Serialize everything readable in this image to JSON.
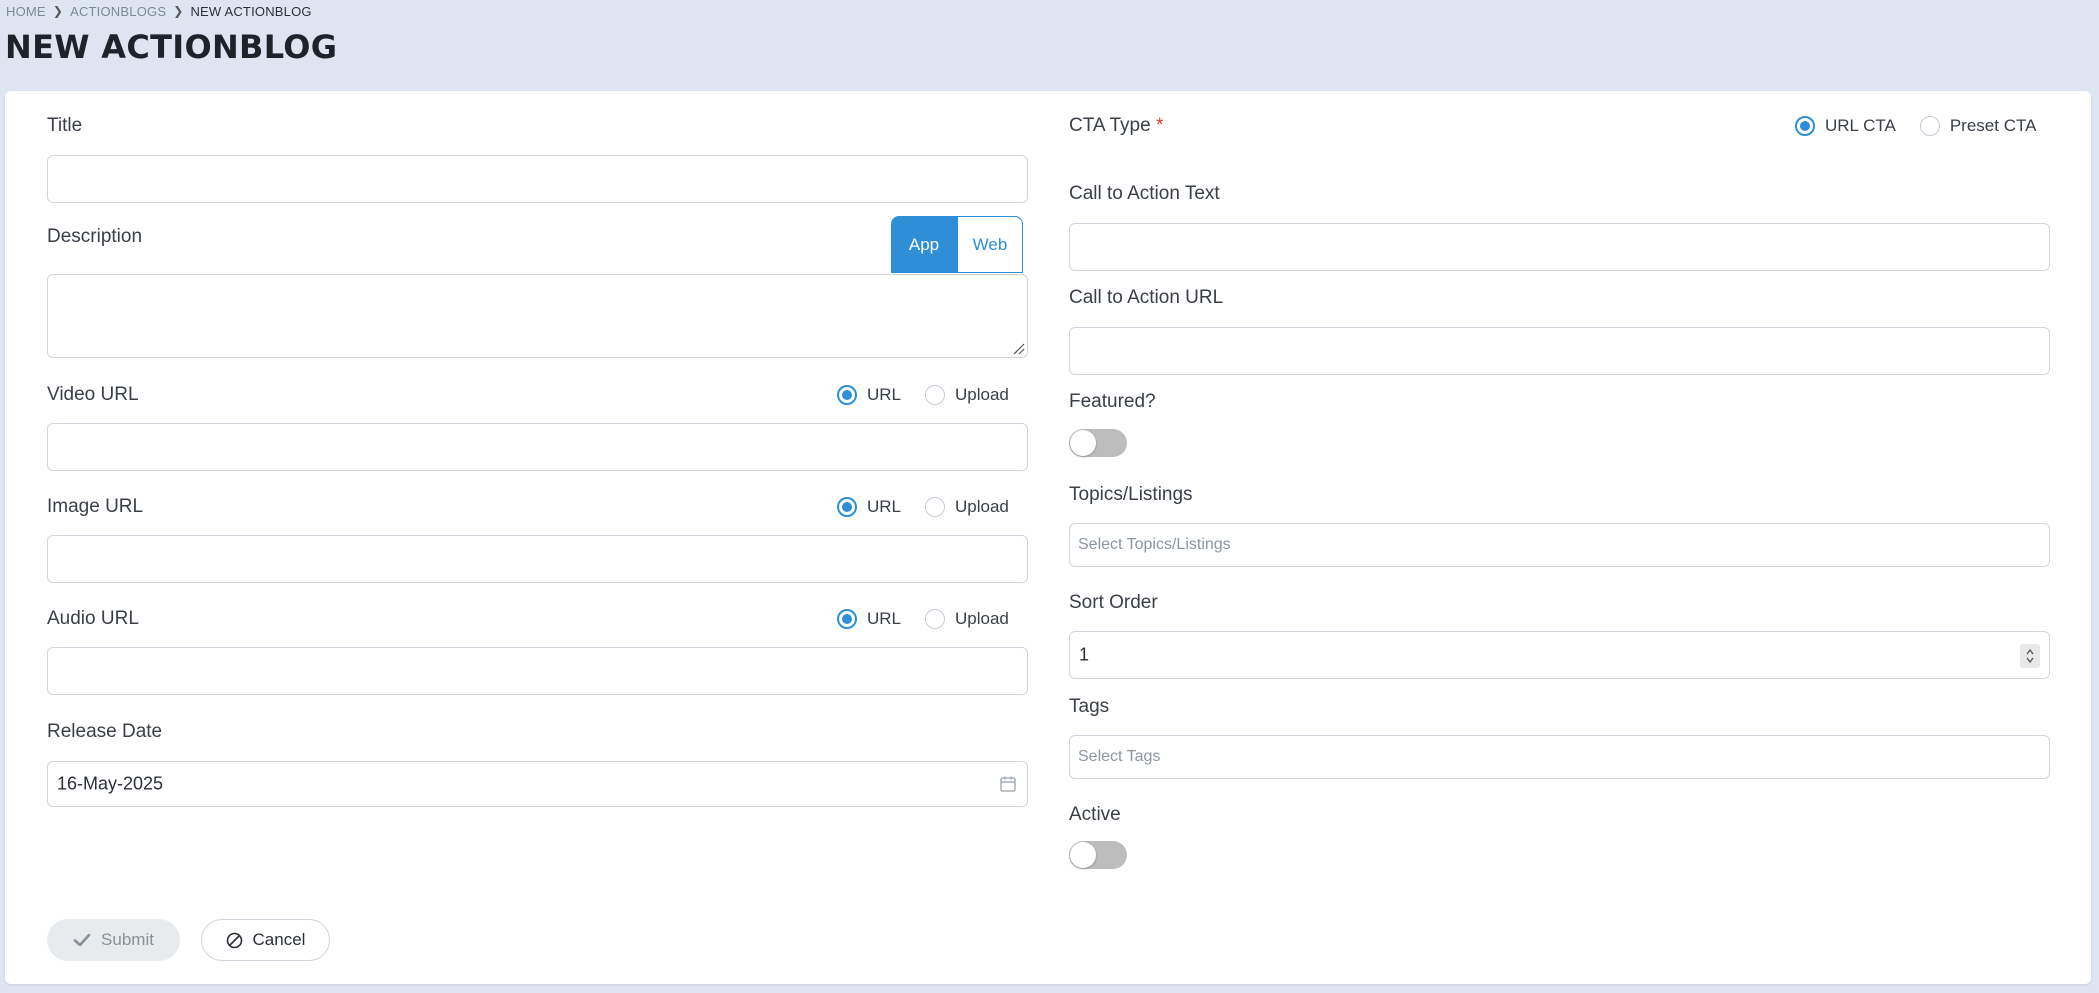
{
  "breadcrumb": {
    "home": "HOME",
    "section": "ACTIONBLOGS",
    "current": "NEW ACTIONBLOG"
  },
  "page": {
    "title": "NEW ACTIONBLOG"
  },
  "form": {
    "title_label": "Title",
    "description_label": "Description",
    "description_tabs": {
      "app": "App",
      "web": "Web",
      "active": "App"
    },
    "video": {
      "label": "Video URL",
      "opt_url": "URL",
      "opt_upload": "Upload",
      "selected": "URL"
    },
    "image": {
      "label": "Image URL",
      "opt_url": "URL",
      "opt_upload": "Upload",
      "selected": "URL"
    },
    "audio": {
      "label": "Audio URL",
      "opt_url": "URL",
      "opt_upload": "Upload",
      "selected": "URL"
    },
    "release_date": {
      "label": "Release Date",
      "value": "16-May-2025"
    },
    "cta_type": {
      "label": "CTA Type",
      "required_mark": "*",
      "opt_url": "URL CTA",
      "opt_preset": "Preset CTA",
      "selected": "URL CTA"
    },
    "cta_text_label": "Call to Action Text",
    "cta_url_label": "Call to Action URL",
    "featured": {
      "label": "Featured?",
      "on": false
    },
    "topics": {
      "label": "Topics/Listings",
      "placeholder": "Select Topics/Listings"
    },
    "sort_order": {
      "label": "Sort Order",
      "value": "1"
    },
    "tags": {
      "label": "Tags",
      "placeholder": "Select Tags"
    },
    "active": {
      "label": "Active",
      "on": false
    }
  },
  "actions": {
    "submit": "Submit",
    "cancel": "Cancel"
  },
  "colors": {
    "accent": "#2e8fd6",
    "background": "#dde6f0",
    "required": "#e23b3b"
  }
}
